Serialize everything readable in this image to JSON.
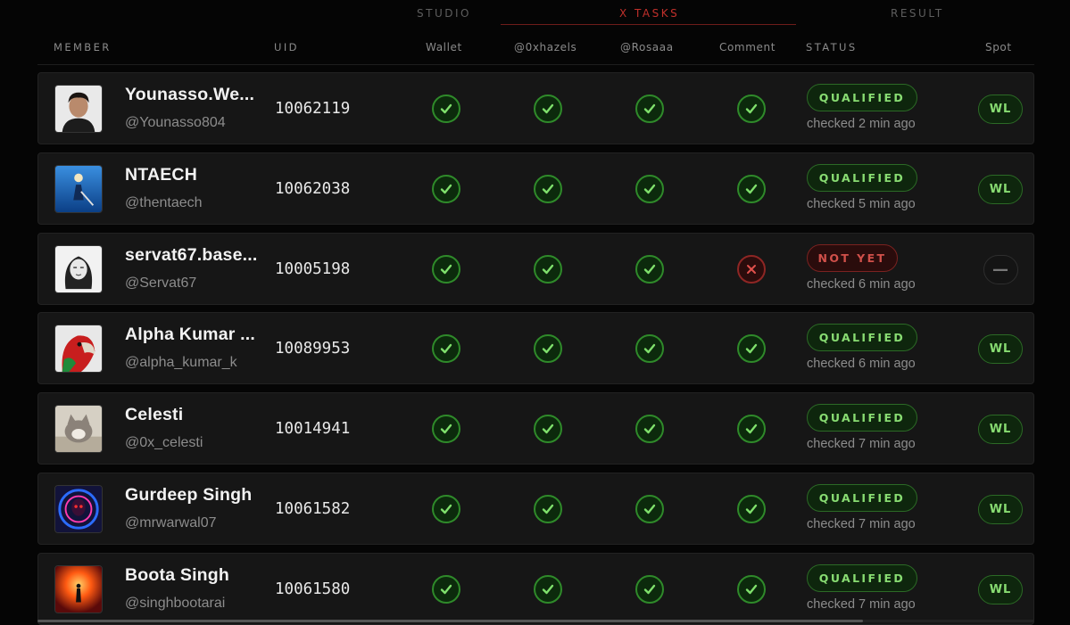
{
  "group_tabs": [
    {
      "label": "STUDIO"
    },
    {
      "label": "X TASKS"
    },
    {
      "label": "RESULT"
    }
  ],
  "columns": {
    "member": "MEMBER",
    "uid": "UID",
    "wallet": "Wallet",
    "task1": "@0xhazels",
    "task2": "@Rosaaa",
    "comment": "Comment",
    "status": "STATUS",
    "spot": "Spot"
  },
  "colors": {
    "accent_red": "#c0302b",
    "ok_green": "#88dc72",
    "fail_red": "#d0504a",
    "row_bg": "#161616"
  },
  "rows": [
    {
      "name": "Younasso.We...",
      "handle": "@Younasso804",
      "uid": "10062119",
      "tasks": [
        "ok",
        "ok",
        "ok",
        "ok"
      ],
      "status": "QUALIFIED",
      "status_type": "q",
      "checked": "checked 2 min ago",
      "spot": "WL",
      "spot_type": "wl",
      "avatar": "portrait"
    },
    {
      "name": "NTAECH",
      "handle": "@thentaech",
      "uid": "10062038",
      "tasks": [
        "ok",
        "ok",
        "ok",
        "ok"
      ],
      "status": "QUALIFIED",
      "status_type": "q",
      "checked": "checked 5 min ago",
      "spot": "WL",
      "spot_type": "wl",
      "avatar": "blue"
    },
    {
      "name": "servat67.base...",
      "handle": "@Servat67",
      "uid": "10005198",
      "tasks": [
        "ok",
        "ok",
        "ok",
        "fail"
      ],
      "status": "NOT YET",
      "status_type": "n",
      "checked": "checked 6 min ago",
      "spot": "—",
      "spot_type": "none",
      "avatar": "sketch"
    },
    {
      "name": "Alpha Kumar ...",
      "handle": "@alpha_kumar_k",
      "uid": "10089953",
      "tasks": [
        "ok",
        "ok",
        "ok",
        "ok"
      ],
      "status": "QUALIFIED",
      "status_type": "q",
      "checked": "checked 6 min ago",
      "spot": "WL",
      "spot_type": "wl",
      "avatar": "parrot"
    },
    {
      "name": "Celesti",
      "handle": "@0x_celesti",
      "uid": "10014941",
      "tasks": [
        "ok",
        "ok",
        "ok",
        "ok"
      ],
      "status": "QUALIFIED",
      "status_type": "q",
      "checked": "checked 7 min ago",
      "spot": "WL",
      "spot_type": "wl",
      "avatar": "cat"
    },
    {
      "name": "Gurdeep Singh",
      "handle": "@mrwarwal07",
      "uid": "10061582",
      "tasks": [
        "ok",
        "ok",
        "ok",
        "ok"
      ],
      "status": "QUALIFIED",
      "status_type": "q",
      "checked": "checked 7 min ago",
      "spot": "WL",
      "spot_type": "wl",
      "avatar": "neon"
    },
    {
      "name": "Boota Singh",
      "handle": "@singhbootarai",
      "uid": "10061580",
      "tasks": [
        "ok",
        "ok",
        "ok",
        "ok"
      ],
      "status": "QUALIFIED",
      "status_type": "q",
      "checked": "checked 7 min ago",
      "spot": "WL",
      "spot_type": "wl",
      "avatar": "fire"
    }
  ]
}
